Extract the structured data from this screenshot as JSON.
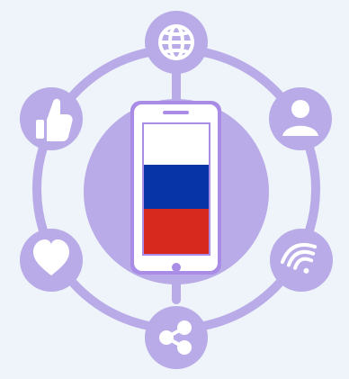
{
  "scene": "russia-social-network-illustration",
  "colors": {
    "background": "#eef4f9",
    "accent": "#b9abe8",
    "phone_frame": "#a98ce6",
    "phone_body": "#ffffff",
    "icon_fill": "#ffffff",
    "flag_white": "#ffffff",
    "flag_blue": "#0735a8",
    "flag_red": "#d7291e"
  },
  "icons": [
    "globe-icon",
    "user-icon",
    "wifi-icon",
    "share-icon",
    "heart-icon",
    "thumbs-up-icon"
  ],
  "flag": {
    "country": "Russia",
    "stripes": [
      "white",
      "blue",
      "red"
    ]
  }
}
